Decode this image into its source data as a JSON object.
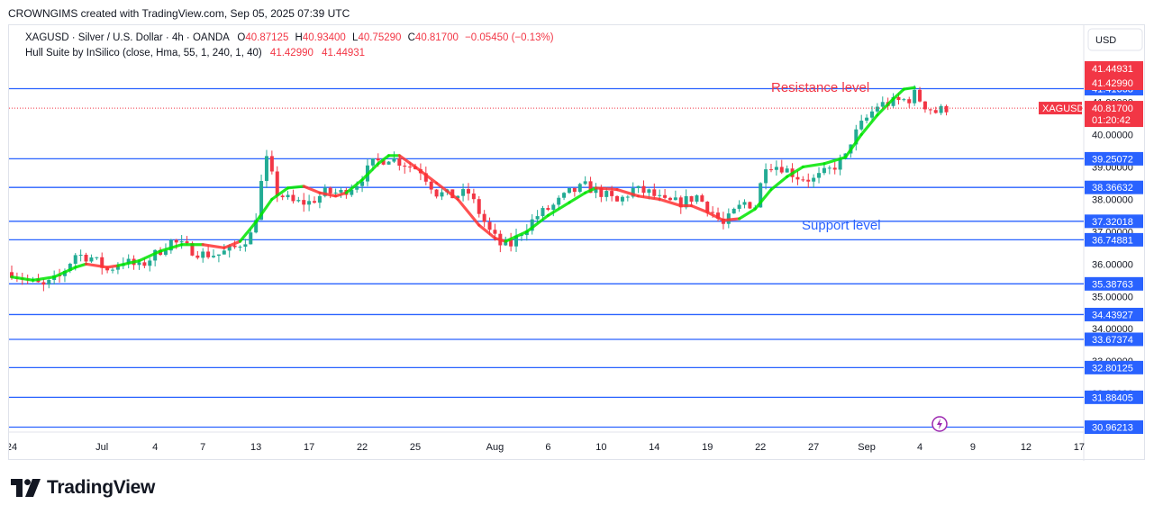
{
  "credit": "CROWNGIMS created with TradingView.com, Sep 05, 2025 07:39 UTC",
  "brand": "TradingView",
  "currency_label": "USD",
  "legend": {
    "symbol": "XAGUSD · Silver / U.S. Dollar · 4h · OANDA",
    "o_label": "O",
    "o": "40.87125",
    "h_label": "H",
    "h": "40.93400",
    "l_label": "L",
    "l": "40.75290",
    "c_label": "C",
    "c": "40.81700",
    "change": "−0.05450 (−0.13%)",
    "indicator": "Hull Suite by InSilico (close, Hma, 55, 1, 240, 1, 40)",
    "ind_v1": "41.42990",
    "ind_v2": "41.44931"
  },
  "annotations": {
    "resistance": "Resistance level",
    "support": "Support level"
  },
  "colors": {
    "bull": "#22ab94",
    "bear": "#f23645",
    "hull_up": "#00e600",
    "hull_down": "#ff3333",
    "level_line": "#2962ff",
    "annotation_red": "#f23645",
    "annotation_blue": "#2962ff",
    "badge_red": "#f23645",
    "badge_blue": "#2962ff"
  },
  "chart_data": {
    "type": "candlestick",
    "symbol": "XAGUSD",
    "timeframe": "4h",
    "ylim": [
      30.6,
      42.0
    ],
    "x_ticks": [
      {
        "label": "24",
        "i": 0
      },
      {
        "label": "Jul",
        "i": 17
      },
      {
        "label": "4",
        "i": 27
      },
      {
        "label": "7",
        "i": 36
      },
      {
        "label": "13",
        "i": 46
      },
      {
        "label": "17",
        "i": 56
      },
      {
        "label": "22",
        "i": 66
      },
      {
        "label": "25",
        "i": 76
      },
      {
        "label": "Aug",
        "i": 91
      },
      {
        "label": "6",
        "i": 101
      },
      {
        "label": "10",
        "i": 111
      },
      {
        "label": "14",
        "i": 121
      },
      {
        "label": "19",
        "i": 131
      },
      {
        "label": "22",
        "i": 141
      },
      {
        "label": "27",
        "i": 151
      },
      {
        "label": "Sep",
        "i": 161
      },
      {
        "label": "4",
        "i": 171
      },
      {
        "label": "9",
        "i": 181
      },
      {
        "label": "12",
        "i": 191
      },
      {
        "label": "17",
        "i": 201
      }
    ],
    "y_ticks": [
      {
        "value": 40.0,
        "label": "40.00000"
      },
      {
        "value": 39.0,
        "label": "39.00000"
      },
      {
        "value": 38.0,
        "label": "38.00000"
      },
      {
        "value": 37.0,
        "label": "37.00000"
      },
      {
        "value": 36.0,
        "label": "36.00000"
      },
      {
        "value": 35.0,
        "label": "35.00000"
      },
      {
        "value": 34.0,
        "label": "34.00000"
      },
      {
        "value": 33.0,
        "label": "33.00000"
      },
      {
        "value": 32.0,
        "label": "32.00000"
      },
      {
        "value": 31.0,
        "label": "31.00000"
      },
      {
        "value": 41.0,
        "label": "41.00000"
      }
    ],
    "horizontal_levels": [
      41.41668,
      39.25072,
      38.36632,
      37.32018,
      36.74881,
      35.38763,
      34.43927,
      33.67374,
      32.80125,
      31.88405,
      30.96213
    ],
    "level_labels": [
      "41.41668",
      "39.25072",
      "38.36632",
      "37.32018",
      "36.74881",
      "35.38763",
      "34.43927",
      "33.67374",
      "32.80125",
      "31.88405",
      "30.96213"
    ],
    "last_price": {
      "value": 40.817,
      "label": "40.81700",
      "countdown": "01:20:42",
      "symbol_tag": "XAGUSD"
    },
    "hull_badges": [
      {
        "value": 41.44931,
        "label": "41.44931"
      },
      {
        "value": 41.4299,
        "label": "41.42990"
      }
    ],
    "close_path": [
      [
        0,
        35.75
      ],
      [
        3,
        35.5
      ],
      [
        6,
        35.3
      ],
      [
        9,
        35.6
      ],
      [
        12,
        36.3
      ],
      [
        15,
        36.2
      ],
      [
        18,
        35.8
      ],
      [
        21,
        36.1
      ],
      [
        24,
        35.9
      ],
      [
        27,
        36.3
      ],
      [
        30,
        36.7
      ],
      [
        33,
        36.5
      ],
      [
        36,
        36.3
      ],
      [
        39,
        36.3
      ],
      [
        42,
        36.5
      ],
      [
        45,
        36.9
      ],
      [
        46,
        37.5
      ],
      [
        47,
        38.5
      ],
      [
        48,
        39.2
      ],
      [
        50,
        38.2
      ],
      [
        53,
        37.9
      ],
      [
        56,
        37.9
      ],
      [
        59,
        38.2
      ],
      [
        62,
        38.2
      ],
      [
        65,
        38.5
      ],
      [
        68,
        39.1
      ],
      [
        71,
        39.3
      ],
      [
        74,
        39.1
      ],
      [
        77,
        38.9
      ],
      [
        80,
        38.2
      ],
      [
        83,
        38.1
      ],
      [
        86,
        38.2
      ],
      [
        88,
        37.6
      ],
      [
        90,
        37.0
      ],
      [
        92,
        36.6
      ],
      [
        94,
        36.6
      ],
      [
        96,
        37.0
      ],
      [
        99,
        37.5
      ],
      [
        102,
        37.8
      ],
      [
        105,
        38.2
      ],
      [
        108,
        38.4
      ],
      [
        111,
        38.2
      ],
      [
        114,
        37.9
      ],
      [
        117,
        38.3
      ],
      [
        120,
        38.2
      ],
      [
        123,
        37.9
      ],
      [
        126,
        37.9
      ],
      [
        129,
        38.1
      ],
      [
        132,
        37.6
      ],
      [
        134,
        37.2
      ],
      [
        136,
        37.6
      ],
      [
        138,
        37.9
      ],
      [
        140,
        37.8
      ],
      [
        142,
        39.1
      ],
      [
        145,
        39.0
      ],
      [
        148,
        38.7
      ],
      [
        151,
        38.6
      ],
      [
        154,
        38.9
      ],
      [
        157,
        39.3
      ],
      [
        158,
        39.8
      ],
      [
        160,
        40.3
      ],
      [
        163,
        40.9
      ],
      [
        166,
        41.0
      ],
      [
        169,
        41.1
      ],
      [
        170,
        41.25
      ],
      [
        172,
        40.9
      ],
      [
        174,
        40.7
      ],
      [
        176,
        40.82
      ]
    ],
    "hull": [
      [
        0,
        35.6,
        "u"
      ],
      [
        4,
        35.5,
        "u"
      ],
      [
        8,
        35.6,
        "u"
      ],
      [
        12,
        35.9,
        "u"
      ],
      [
        14,
        36.0,
        "d"
      ],
      [
        18,
        35.9,
        "d"
      ],
      [
        20,
        35.95,
        "u"
      ],
      [
        24,
        36.1,
        "u"
      ],
      [
        28,
        36.4,
        "u"
      ],
      [
        32,
        36.6,
        "u"
      ],
      [
        36,
        36.6,
        "d"
      ],
      [
        40,
        36.5,
        "d"
      ],
      [
        43,
        36.7,
        "u"
      ],
      [
        46,
        37.3,
        "u"
      ],
      [
        49,
        38.0,
        "u"
      ],
      [
        52,
        38.35,
        "u"
      ],
      [
        55,
        38.4,
        "d"
      ],
      [
        58,
        38.2,
        "d"
      ],
      [
        61,
        38.1,
        "d"
      ],
      [
        63,
        38.2,
        "u"
      ],
      [
        66,
        38.6,
        "u"
      ],
      [
        69,
        39.1,
        "u"
      ],
      [
        71,
        39.35,
        "u"
      ],
      [
        73,
        39.35,
        "d"
      ],
      [
        76,
        39.0,
        "d"
      ],
      [
        80,
        38.5,
        "d"
      ],
      [
        84,
        38.0,
        "d"
      ],
      [
        88,
        37.2,
        "d"
      ],
      [
        91,
        36.8,
        "d"
      ],
      [
        93,
        36.7,
        "u"
      ],
      [
        97,
        37.0,
        "u"
      ],
      [
        101,
        37.5,
        "u"
      ],
      [
        105,
        37.9,
        "u"
      ],
      [
        108,
        38.2,
        "u"
      ],
      [
        110,
        38.35,
        "d"
      ],
      [
        114,
        38.3,
        "d"
      ],
      [
        118,
        38.1,
        "d"
      ],
      [
        122,
        38.0,
        "d"
      ],
      [
        126,
        37.8,
        "d"
      ],
      [
        128,
        37.8,
        "d"
      ],
      [
        131,
        37.6,
        "d"
      ],
      [
        134,
        37.35,
        "d"
      ],
      [
        137,
        37.4,
        "u"
      ],
      [
        140,
        37.7,
        "u"
      ],
      [
        143,
        38.3,
        "u"
      ],
      [
        146,
        38.7,
        "u"
      ],
      [
        149,
        39.0,
        "u"
      ],
      [
        153,
        39.1,
        "u"
      ],
      [
        157,
        39.3,
        "u"
      ],
      [
        160,
        40.0,
        "u"
      ],
      [
        163,
        40.6,
        "u"
      ],
      [
        166,
        41.1,
        "u"
      ],
      [
        168,
        41.4,
        "u"
      ],
      [
        170,
        41.45,
        "u"
      ]
    ]
  }
}
